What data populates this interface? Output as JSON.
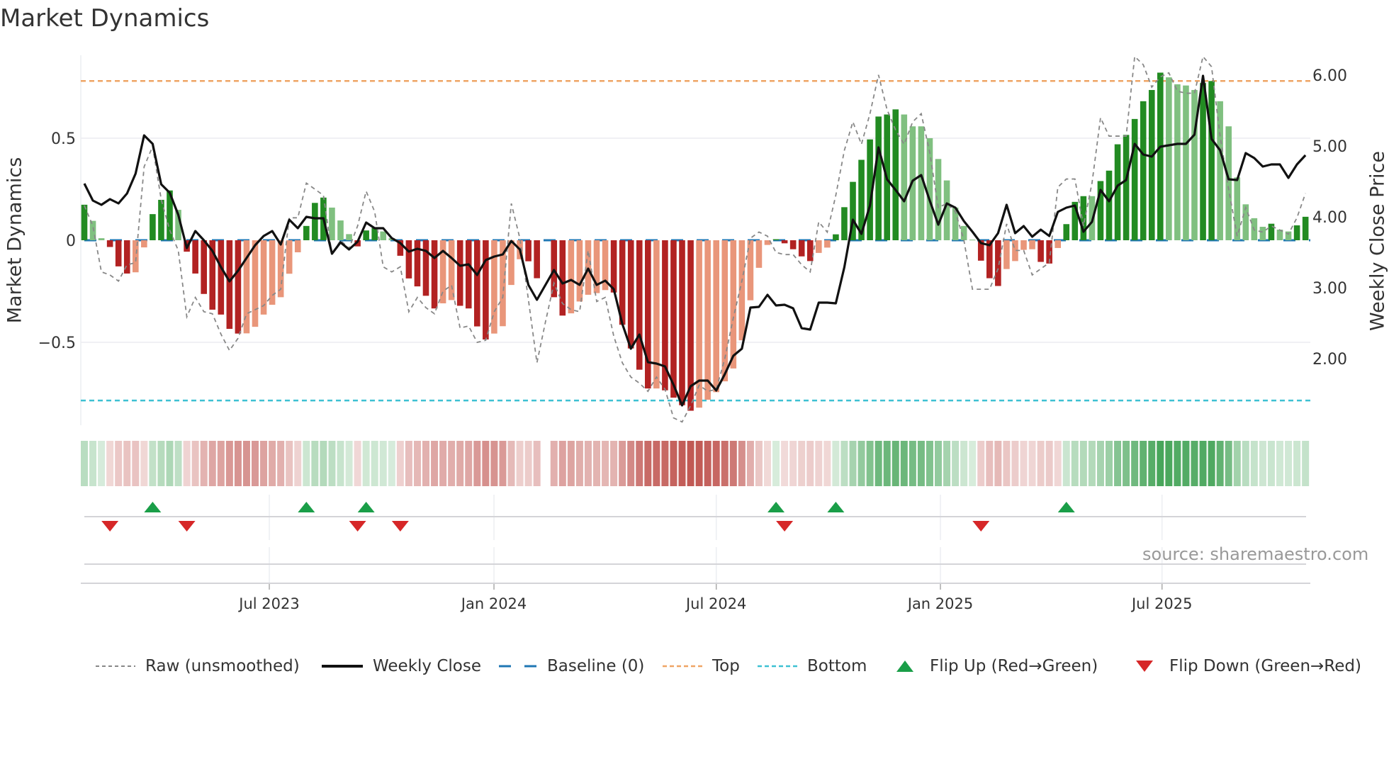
{
  "title": "Market Dynamics",
  "source": "source: sharemaestro.com",
  "colors": {
    "up_strong": "#228b22",
    "up_weak": "#80c080",
    "down_strong": "#b22222",
    "down_weak": "#e9967a",
    "price": "#111111",
    "raw": "#888888",
    "baseline": "#1f77b4",
    "top": "#efa565",
    "bottom": "#3ec1d3",
    "flip_up": "#1a9e48",
    "flip_down": "#d62728",
    "strip_green": "60,160,80",
    "strip_red": "190,80,75"
  },
  "legend": {
    "raw": "Raw (unsmoothed)",
    "close": "Weekly Close",
    "baseline": "Baseline (0)",
    "top": "Top",
    "bottom": "Bottom",
    "flip_up": "Flip Up (Red→Green)",
    "flip_down": "Flip Down (Green→Red)"
  },
  "chart_data": {
    "type": "bar",
    "title": "Market Dynamics",
    "ylabel": "Market Dynamics",
    "y2label": "Weekly Close Price",
    "ylim": [
      -0.906,
      0.906
    ],
    "y2lim": [
      1.06,
      6.28
    ],
    "yticks": [
      {
        "v": 0.5,
        "label": "0.5"
      },
      {
        "v": 0,
        "label": "0"
      },
      {
        "v": -0.5,
        "label": "−0.5"
      }
    ],
    "y2ticks": [
      {
        "v": 6,
        "label": "6.00"
      },
      {
        "v": 5,
        "label": "5.00"
      },
      {
        "v": 4,
        "label": "4.00"
      },
      {
        "v": 3,
        "label": "3.00"
      },
      {
        "v": 2,
        "label": "2.00"
      }
    ],
    "xticks": [
      {
        "week": 21.66,
        "label": "Jul 2023"
      },
      {
        "week": 47.97,
        "label": "Jan 2024"
      },
      {
        "week": 74.0,
        "label": "Jul 2024"
      },
      {
        "week": 100.25,
        "label": "Jan 2025"
      },
      {
        "week": 126.2,
        "label": "Jul 2025"
      }
    ],
    "top_level": 0.78,
    "bottom_level": -0.785,
    "baseline": 0,
    "grid": true,
    "legend_placement": "bottom",
    "series": [
      {
        "name": "Market Dynamics (smoothed)",
        "kind": "bar",
        "values": [
          0.174,
          0.095,
          0.01,
          -0.033,
          -0.128,
          -0.163,
          -0.157,
          -0.035,
          0.128,
          0.198,
          0.244,
          0.149,
          -0.056,
          -0.163,
          -0.263,
          -0.34,
          -0.364,
          -0.434,
          -0.457,
          -0.456,
          -0.424,
          -0.364,
          -0.316,
          -0.279,
          -0.164,
          -0.059,
          0.07,
          0.183,
          0.209,
          0.16,
          0.097,
          0.03,
          -0.03,
          0.048,
          0.06,
          0.043,
          0.01,
          -0.076,
          -0.187,
          -0.226,
          -0.272,
          -0.334,
          -0.309,
          -0.293,
          -0.321,
          -0.334,
          -0.422,
          -0.486,
          -0.457,
          -0.421,
          -0.219,
          -0.093,
          -0.103,
          -0.186,
          null,
          -0.279,
          -0.369,
          -0.358,
          -0.3,
          -0.267,
          -0.259,
          -0.244,
          -0.256,
          -0.414,
          -0.53,
          -0.634,
          -0.726,
          -0.726,
          -0.735,
          -0.771,
          -0.808,
          -0.835,
          -0.82,
          -0.781,
          -0.744,
          -0.691,
          -0.628,
          -0.49,
          -0.294,
          -0.135,
          -0.023,
          0.005,
          -0.015,
          -0.044,
          -0.079,
          -0.102,
          -0.062,
          -0.036,
          0.029,
          0.162,
          0.286,
          0.394,
          0.494,
          0.606,
          0.616,
          0.641,
          0.616,
          0.558,
          0.558,
          0.5,
          0.398,
          0.293,
          0.16,
          0.07,
          0.003,
          -0.1,
          -0.186,
          -0.224,
          -0.141,
          -0.102,
          -0.047,
          -0.044,
          -0.106,
          -0.114,
          -0.038,
          0.079,
          0.188,
          0.216,
          0.216,
          0.29,
          0.341,
          0.47,
          0.516,
          0.594,
          0.681,
          0.736,
          0.821,
          0.798,
          0.764,
          0.758,
          0.736,
          0.77,
          0.78,
          0.681,
          0.558,
          0.308,
          0.176,
          0.108,
          0.066,
          0.081,
          0.052,
          0.043,
          0.073,
          0.115
        ]
      },
      {
        "name": "Raw (unsmoothed)",
        "kind": "line",
        "values": [
          0.17,
          0.07,
          -0.155,
          -0.17,
          -0.2,
          -0.12,
          -0.11,
          0.36,
          0.46,
          0.2,
          0.05,
          -0.05,
          -0.375,
          -0.28,
          -0.35,
          -0.36,
          -0.46,
          -0.54,
          -0.48,
          -0.36,
          -0.34,
          -0.32,
          -0.27,
          -0.24,
          0.11,
          0.11,
          0.28,
          0.25,
          0.22,
          -0.07,
          0.0,
          -0.04,
          0.07,
          0.24,
          0.14,
          -0.13,
          -0.155,
          -0.13,
          -0.35,
          -0.28,
          -0.33,
          -0.36,
          -0.25,
          -0.22,
          -0.43,
          -0.42,
          -0.5,
          -0.49,
          -0.35,
          -0.28,
          0.18,
          0.01,
          -0.29,
          -0.6,
          -0.4,
          -0.21,
          -0.31,
          -0.34,
          -0.35,
          -0.05,
          -0.3,
          -0.28,
          -0.47,
          -0.6,
          -0.67,
          -0.7,
          -0.74,
          -0.67,
          -0.73,
          -0.87,
          -0.89,
          -0.81,
          -0.71,
          -0.74,
          -0.73,
          -0.58,
          -0.38,
          -0.2,
          0.01,
          0.04,
          0.02,
          -0.06,
          -0.07,
          -0.07,
          -0.12,
          -0.155,
          0.09,
          0.04,
          0.22,
          0.44,
          0.58,
          0.47,
          0.62,
          0.81,
          0.64,
          0.54,
          0.47,
          0.58,
          0.62,
          0.43,
          0.16,
          0.18,
          0.14,
          0.0,
          -0.24,
          -0.24,
          -0.24,
          -0.14,
          0.08,
          -0.05,
          -0.05,
          -0.17,
          -0.14,
          -0.11,
          0.26,
          0.3,
          0.3,
          0.07,
          0.28,
          0.6,
          0.51,
          0.51,
          0.51,
          0.9,
          0.86,
          0.75,
          0.8,
          0.82,
          0.73,
          0.72,
          0.72,
          0.9,
          0.85,
          0.51,
          0.25,
          0.02,
          0.16,
          0.05,
          0.04,
          0.07,
          0.05,
          0.03,
          0.11,
          0.23
        ]
      },
      {
        "name": "Weekly Close",
        "kind": "line",
        "axis": "right",
        "values": [
          4.47,
          4.23,
          4.17,
          4.25,
          4.19,
          4.33,
          4.61,
          5.15,
          5.03,
          4.46,
          4.34,
          4.03,
          3.56,
          3.8,
          3.67,
          3.52,
          3.29,
          3.09,
          3.24,
          3.42,
          3.6,
          3.73,
          3.8,
          3.61,
          3.96,
          3.84,
          4.0,
          3.98,
          3.98,
          3.48,
          3.64,
          3.54,
          3.65,
          3.92,
          3.84,
          3.84,
          3.7,
          3.63,
          3.51,
          3.55,
          3.52,
          3.42,
          3.52,
          3.42,
          3.31,
          3.33,
          3.18,
          3.39,
          3.44,
          3.47,
          3.66,
          3.54,
          3.04,
          2.83,
          3.04,
          3.25,
          3.06,
          3.11,
          3.04,
          3.27,
          3.04,
          3.1,
          2.98,
          2.49,
          2.14,
          2.34,
          1.95,
          1.93,
          1.89,
          1.63,
          1.34,
          1.61,
          1.69,
          1.69,
          1.55,
          1.78,
          2.04,
          2.14,
          2.72,
          2.73,
          2.9,
          2.75,
          2.76,
          2.71,
          2.43,
          2.41,
          2.79,
          2.79,
          2.78,
          3.29,
          3.96,
          3.76,
          4.16,
          4.98,
          4.53,
          4.38,
          4.22,
          4.51,
          4.59,
          4.23,
          3.89,
          4.19,
          4.13,
          3.94,
          3.79,
          3.63,
          3.6,
          3.77,
          4.17,
          3.77,
          3.87,
          3.72,
          3.82,
          3.73,
          4.07,
          4.13,
          4.16,
          3.79,
          3.93,
          4.38,
          4.22,
          4.44,
          4.52,
          5.03,
          4.88,
          4.85,
          4.99,
          5.01,
          5.03,
          5.03,
          5.16,
          5.99,
          5.1,
          4.94,
          4.53,
          4.52,
          4.9,
          4.83,
          4.71,
          4.74,
          4.74,
          4.55,
          4.74,
          4.87
        ]
      }
    ]
  }
}
